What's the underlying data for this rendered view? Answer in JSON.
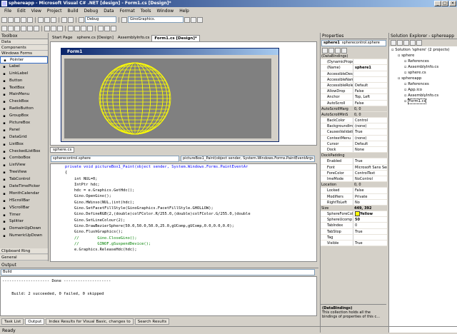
{
  "window": {
    "title": "sphereapp - Microsoft Visual C# .NET [design] - Form1.cs [Design]*",
    "min": "_",
    "max": "□",
    "close": "×"
  },
  "menu": [
    "File",
    "Edit",
    "View",
    "Project",
    "Build",
    "Debug",
    "Data",
    "Format",
    "Tools",
    "Window",
    "Help"
  ],
  "toolbar": {
    "config": "Debug",
    "find": "GinoGraphics."
  },
  "toolbox": {
    "title": "Toolbox",
    "sections": [
      "Data",
      "Components",
      "Windows Forms"
    ],
    "items": [
      "Pointer",
      "Label",
      "LinkLabel",
      "Button",
      "TextBox",
      "MainMenu",
      "CheckBox",
      "RadioButton",
      "GroupBox",
      "PictureBox",
      "Panel",
      "DataGrid",
      "ListBox",
      "CheckedListBox",
      "ComboBox",
      "ListView",
      "TreeView",
      "TabControl",
      "DateTimePicker",
      "MonthCalendar",
      "HScrollBar",
      "VScrollBar",
      "Timer",
      "Splitter",
      "DomainUpDown",
      "NumericUpDown"
    ],
    "bottom": [
      "Clipboard Ring",
      "General"
    ]
  },
  "doc_tabs": [
    "Start Page",
    "sphere.cs [Design]",
    "AssemblyInfo.cs",
    "Form1.cs [Design]*"
  ],
  "form": {
    "title": "Form1"
  },
  "code": {
    "tab": "sphere.cs",
    "combo1": "spherecontrol.sphere",
    "combo2": "pictureBox1_Paint(object sender, System.Windows.Forms.PaintEventArgs e)",
    "lines": [
      {
        "t": "private void pictureBox1_Paint(object sender, System.Windows.Forms.PaintEventAr",
        "c": "kw"
      },
      {
        "t": "{",
        "c": ""
      },
      {
        "t": "    int NUL=0;",
        "c": ""
      },
      {
        "t": "    IntPtr hdc;",
        "c": ""
      },
      {
        "t": "    hdc = e.Graphics.GetHdc();",
        "c": ""
      },
      {
        "t": "    Gino.OpenGino();",
        "c": ""
      },
      {
        "t": "    Gino.HWinso(NUL,(int)hdc);",
        "c": ""
      },
      {
        "t": "    Gino.SetFacetFillStyle(GinoGraphics.FacetFillStyle.GHOLLOW);",
        "c": ""
      },
      {
        "t": "    Gino.DefineRGB(2,(double)colFColor.R/255.0,(double)colFColor.G/255.0,(double",
        "c": ""
      },
      {
        "t": "    Gino.SetLineColour(2);",
        "c": ""
      },
      {
        "t": "    Gino.DrawBezierSphere(50.0,50.0,50.0,25.0,gUComp,gUComp,0.0,0.0,0.0);",
        "c": ""
      },
      {
        "t": "    Gino.FlushGraphics();",
        "c": ""
      },
      {
        "t": "    //        Gino.CloseGino();",
        "c": "cm"
      },
      {
        "t": "    //        GINOF.gSuspendDevice();",
        "c": "cm"
      },
      {
        "t": "    e.Graphics.ReleaseHdc(hdc);",
        "c": ""
      }
    ]
  },
  "output": {
    "title": "Output",
    "combo": "Build",
    "text": "-------------------- Done --------------------\n\n    Build: 2 succeeded, 0 failed, 0 skipped"
  },
  "bottom_tabs": [
    "Task List",
    "Output",
    "Index Results for Visual Basic, changes to",
    "Search Results"
  ],
  "status": "Ready",
  "properties": {
    "title": "Properties",
    "object": "sphere1",
    "type": "spherecontrol.sphere",
    "rows": [
      [
        "(DataBindings)",
        "",
        "cat"
      ],
      [
        "(DynamicPrope",
        "",
        ""
      ],
      [
        "(Name)",
        "sphere1",
        ""
      ],
      [
        "AccessibleDesc",
        "",
        ""
      ],
      [
        "AccessibleName",
        "",
        ""
      ],
      [
        "AccessibleRole",
        "Default",
        ""
      ],
      [
        "AllowDrop",
        "False",
        ""
      ],
      [
        "Anchor",
        "Top, Left",
        ""
      ],
      [
        "AutoScroll",
        "False",
        ""
      ],
      [
        "AutoScrollMarg",
        "0, 0",
        "cat"
      ],
      [
        "AutoScrollMinS",
        "0, 0",
        "cat"
      ],
      [
        "BackColor",
        "Control",
        ""
      ],
      [
        "BackgroundIma",
        "(none)",
        ""
      ],
      [
        "CausesValidati",
        "True",
        ""
      ],
      [
        "ContextMenu",
        "(none)",
        ""
      ],
      [
        "Cursor",
        "Default",
        ""
      ],
      [
        "Dock",
        "None",
        ""
      ],
      [
        "DockPadding",
        "",
        "cat"
      ],
      [
        "Enabled",
        "True",
        ""
      ],
      [
        "Font",
        "Microsoft Sans Serif",
        ""
      ],
      [
        "ForeColor",
        "ControlText",
        ""
      ],
      [
        "ImeMode",
        "NoControl",
        ""
      ],
      [
        "Location",
        "0, 0",
        "cat"
      ],
      [
        "Locked",
        "False",
        ""
      ],
      [
        "Modifiers",
        "Private",
        ""
      ],
      [
        "RightToLeft",
        "No",
        ""
      ],
      [
        "Size",
        "449, 392",
        "cat"
      ],
      [
        "SphereForeCol",
        "Yellow",
        ""
      ],
      [
        "SphereUcomp",
        "50",
        ""
      ],
      [
        "TabIndex",
        "0",
        ""
      ],
      [
        "TabStop",
        "True",
        ""
      ],
      [
        "Tag",
        "",
        ""
      ],
      [
        "Visible",
        "True",
        ""
      ]
    ],
    "desc_title": "(DataBindings)",
    "desc": "This collection holds all the bindings of properties of this c..."
  },
  "solution": {
    "title": "Solution Explorer - sphereapp",
    "tree": [
      [
        "Solution 'sphere' (2 projects)",
        0
      ],
      [
        "sphere",
        1
      ],
      [
        "References",
        2
      ],
      [
        "AssemblyInfo.cs",
        2
      ],
      [
        "sphere.cs",
        2
      ],
      [
        "sphereapp",
        1
      ],
      [
        "References",
        2
      ],
      [
        "App.ico",
        2
      ],
      [
        "AssemblyInfo.cs",
        2
      ],
      [
        "Form1.cs",
        2
      ]
    ]
  },
  "colors": {
    "accent": "#0a246a",
    "sphere": "#ffff00"
  }
}
